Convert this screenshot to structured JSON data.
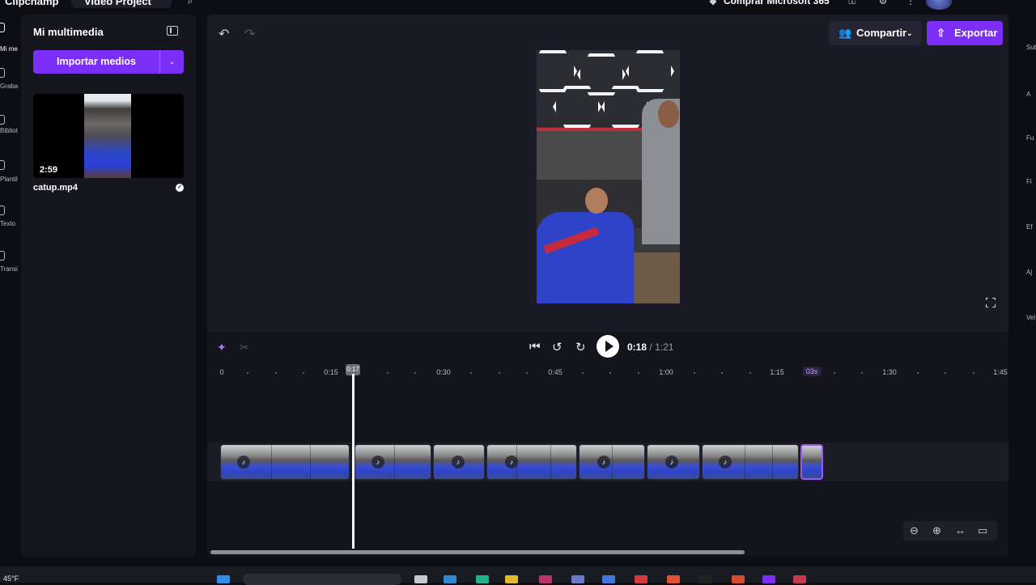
{
  "topbar": {
    "app_name": "Clipchamp",
    "project_name": "Video Project",
    "promo": "Comprar Microsoft 365"
  },
  "leftrail": {
    "items": [
      "Mi medios",
      "Grabar y crear",
      "Biblioteca",
      "Plantillas",
      "Texto",
      "Transiciones"
    ]
  },
  "media": {
    "title": "Mi multimedia",
    "import_label": "Importar medios",
    "file": {
      "name": "catup.mp4",
      "duration": "2:59"
    }
  },
  "editor": {
    "share_label": "Compartir",
    "export_label": "Exportar"
  },
  "timeline": {
    "current_time": "0:18",
    "separator": "/",
    "total_time": "1:21",
    "playhead_label": "0:17",
    "ruler_labels": [
      "0",
      "0:15",
      "0:30",
      "0:45",
      "1:00",
      "1:15",
      "03s",
      "1:30",
      "1:45"
    ]
  },
  "rightrail": {
    "items": [
      "Sub",
      "A",
      "Fu",
      "Fi",
      "Ef",
      "Aj",
      "Vel"
    ]
  },
  "taskbar": {
    "temperature": "45°F"
  },
  "colors": {
    "accent": "#7b2ff7",
    "panel": "#16161f",
    "editor_bg": "#1b1b27",
    "timeline_bg": "#14141c"
  }
}
